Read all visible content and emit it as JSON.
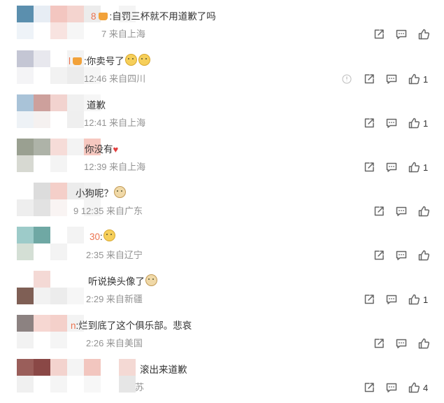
{
  "comments": [
    {
      "pre": "8",
      "badge": true,
      "text": ":自罚三杯就不用道歉了吗",
      "emojis": [],
      "meta": "7 来自上海",
      "likes": "",
      "share_hidden": false,
      "dislike": false,
      "tiles": [
        [
          "#5b8fae",
          "#e7edf4",
          "#f3c6c0",
          "#f4d4cf",
          "#ececec",
          "#f4f4f4"
        ],
        [
          "#eef3f8",
          "#ffffff",
          "#f8e3e0",
          "#f6f6f6",
          "#ffffff",
          ""
        ]
      ]
    },
    {
      "pre": "l",
      "badge": true,
      "text": ":你卖号了",
      "emojis": [
        "smile",
        "smile"
      ],
      "meta": "12:46 来自四川",
      "likes": "1",
      "share_hidden": false,
      "dislike": true,
      "tiles": [
        [
          "#c4c6d4",
          "#e8e8ee",
          "#ffffff",
          "#f3f3f3",
          "#ffffff",
          ""
        ],
        [
          "#f4f4f6",
          "#ffffff",
          "#f2f2f2",
          "#ececec",
          "#f6f6f6",
          ""
        ]
      ]
    },
    {
      "pre": "",
      "badge": false,
      "text": "道歉",
      "emojis": [],
      "meta": "12:41 来自上海",
      "likes": "1",
      "share_hidden": false,
      "dislike": false,
      "tiles": [
        [
          "#a9c3d8",
          "#cda09c",
          "#f2d3cf",
          "#f0f0f0",
          "#f6f6f6",
          ""
        ],
        [
          "#eef2f6",
          "#f5f1f0",
          "#ffffff",
          "#efefef",
          "#ffffff",
          ""
        ]
      ]
    },
    {
      "pre": "",
      "badge": false,
      "text": "你没有",
      "emojis": [
        "heart"
      ],
      "meta": "12:39 来自上海",
      "likes": "1",
      "share_hidden": false,
      "dislike": false,
      "tiles": [
        [
          "#9aa091",
          "#aeb3a8",
          "#f6dcd8",
          "#f3f3f3",
          "#f6c8c0",
          ""
        ],
        [
          "#d7d9d2",
          "#ffffff",
          "#f4f4f4",
          "#ffffff",
          "#ffffff",
          ""
        ]
      ]
    },
    {
      "pre": "",
      "badge": false,
      "text": "小狗呢？",
      "emojis": [
        "dog"
      ],
      "meta": "9 12:35 来自广东",
      "likes": "",
      "share_hidden": false,
      "dislike": false,
      "tiles": [
        [
          "#ffffff",
          "#dcdcdc",
          "#f4cfc9",
          "#ececec",
          "#f0f0f0",
          ""
        ],
        [
          "#eeeeee",
          "#e2e2e2",
          "#f9f4f3",
          "#ffffff",
          "#f4f4f4",
          ""
        ]
      ]
    },
    {
      "pre": "30",
      "badge": false,
      "text": ":",
      "emojis": [
        "smile"
      ],
      "meta": "2:35 来自辽宁",
      "likes": "",
      "share_hidden": false,
      "dislike": false,
      "tiles": [
        [
          "#9dcbc9",
          "#6fa8a4",
          "#ffffff",
          "#f3f3f3",
          "#ffffff",
          ""
        ],
        [
          "#d4dfd5",
          "#ffffff",
          "#f3f3f3",
          "#ffffff",
          "#ffffff",
          ""
        ]
      ]
    },
    {
      "pre": "",
      "badge": false,
      "text": "听说换头像了",
      "emojis": [
        "dog"
      ],
      "meta": "2:29 来自新疆",
      "likes": "1",
      "share_hidden": false,
      "dislike": false,
      "tiles": [
        [
          "#ffffff",
          "#f4d9d5",
          "#ffffff",
          "#ffffff",
          "#ffffff",
          ""
        ],
        [
          "#7f5f55",
          "#f2f2f2",
          "#ececec",
          "#f6f6f6",
          "#ffffff",
          ""
        ]
      ]
    },
    {
      "pre": "n",
      "badge": false,
      "text": ":烂到底了这个俱乐部。悲哀",
      "emojis": [],
      "meta": "2:26 来自美国",
      "likes": "",
      "share_hidden": false,
      "dislike": false,
      "tiles": [
        [
          "#8c8281",
          "#f6d7d2",
          "#f4d0ca",
          "#f3f3f3",
          "#ffffff",
          ""
        ],
        [
          "#f2f2f2",
          "#ffffff",
          "#f5f5f5",
          "#ffffff",
          "#ffffff",
          ""
        ]
      ]
    },
    {
      "pre": "",
      "badge": false,
      "text": "滚出来道歉",
      "emojis": [],
      "meta": "苏",
      "likes": "4",
      "share_hidden": false,
      "dislike": false,
      "tiles": [
        [
          "#9a5e5a",
          "#8a4846",
          "#f3d3ce",
          "#f4f4f4",
          "#f2c6bf",
          "#f4d9d4"
        ],
        [
          "#f0f0f0",
          "#ffffff",
          "#f5f5f5",
          "#ffffff",
          "#f7f7f7",
          "#e6e6e6"
        ]
      ]
    }
  ],
  "icons": {
    "share": "share-icon",
    "comment": "comment-icon",
    "like": "thumbs-up-icon",
    "dislike": "thumbs-down-icon"
  }
}
